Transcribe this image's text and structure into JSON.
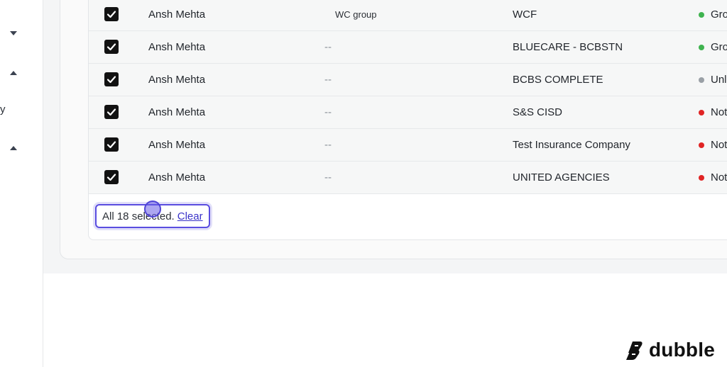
{
  "sidebar": {
    "partial_label": "y"
  },
  "table": {
    "rows": [
      {
        "name": "Ansh Mehta",
        "group": "WC group",
        "insurance": "WCF",
        "status": "Gro",
        "status_color": "#3fb34f"
      },
      {
        "name": "Ansh Mehta",
        "group": "--",
        "insurance": "BLUECARE - BCBSTN",
        "status": "Gro",
        "status_color": "#3fb34f"
      },
      {
        "name": "Ansh Mehta",
        "group": "--",
        "insurance": "BCBS COMPLETE",
        "status": "Unl",
        "status_color": "#9aa0a6"
      },
      {
        "name": "Ansh Mehta",
        "group": "--",
        "insurance": "S&S CISD",
        "status": "Not",
        "status_color": "#e02424"
      },
      {
        "name": "Ansh Mehta",
        "group": "--",
        "insurance": "Test Insurance Company",
        "status": "Not",
        "status_color": "#e02424"
      },
      {
        "name": "Ansh Mehta",
        "group": "--",
        "insurance": "UNITED AGENCIES",
        "status": "Not",
        "status_color": "#e02424"
      }
    ]
  },
  "selection": {
    "text": "All 18 selected.",
    "clear_label": "Clear"
  },
  "brand": {
    "name": "dubble"
  }
}
